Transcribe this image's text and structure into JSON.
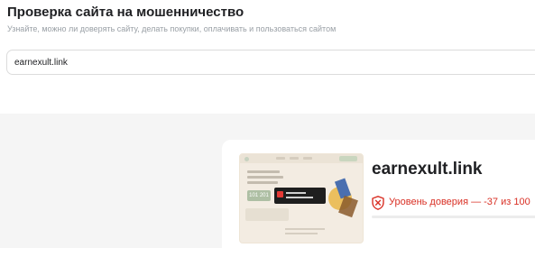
{
  "header": {
    "title": "Проверка сайта на мошенничество",
    "subtitle": "Узнайте, можно ли доверять сайту, делать покупки, оплачивать и пользоваться сайтом"
  },
  "search": {
    "value": "earnexult.link"
  },
  "result": {
    "site_name": "earnexult.link",
    "trust_label": "Уровень доверия — -37 из 100",
    "trust_score": -37,
    "trust_max": 100,
    "thumbnail_number": "101 201"
  },
  "colors": {
    "danger": "#d93025",
    "background": "#f5f5f5",
    "text": "#202124",
    "muted": "#9aa0a6"
  },
  "icons": {
    "trust": "shield-icon"
  }
}
